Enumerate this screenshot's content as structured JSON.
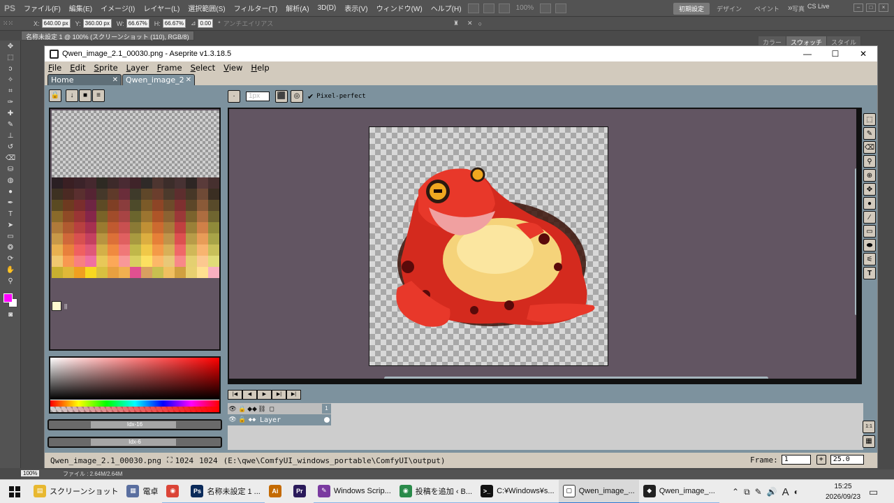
{
  "ps": {
    "logo": "PS",
    "menus": [
      "ファイル(F)",
      "編集(E)",
      "イメージ(I)",
      "レイヤー(L)",
      "選択範囲(S)",
      "フィルター(T)",
      "解析(A)",
      "3D(D)",
      "表示(V)",
      "ウィンドウ(W)",
      "ヘルプ(H)"
    ],
    "zoom_menu": "100%",
    "workspaces": [
      "初期設定",
      "デザイン",
      "ペイント",
      "写真"
    ],
    "search_icon": "»",
    "cs_live": "CS Live",
    "options": {
      "x_label": "X:",
      "x_value": "640.00 px",
      "y_label": "Y:",
      "y_value": "360.00 px",
      "w_label": "W:",
      "w_value": "66.67%",
      "h_label": "H:",
      "h_value": "66.67%",
      "angle_value": "0.00",
      "angle_unit": "°",
      "antialias": "アンチエイリアス",
      "commit_icons": [
        "✕",
        "○"
      ]
    },
    "doc_tab": "名称未設定 1 @ 100% (スクリーンショット (110), RGB/8)",
    "panel_tabs": [
      "カラー",
      "スウォッチ",
      "スタイル"
    ],
    "status_zoom": "100%",
    "status_file": "ファイル : 2.64M/2.64M"
  },
  "aseprite": {
    "title": "Qwen_image_2.1_00030.png - Aseprite v1.3.18.5",
    "win_controls": [
      "—",
      "☐",
      "✕"
    ],
    "menus": [
      "File",
      "Edit",
      "Sprite",
      "Layer",
      "Frame",
      "Select",
      "View",
      "Help"
    ],
    "tabs": [
      {
        "label": "Home",
        "close": "✕"
      },
      {
        "label": "Qwen_image_2",
        "close": "✕"
      }
    ],
    "toolopts": {
      "size_placeholder": "1px",
      "pixel_perfect": "Pixel-perfect",
      "check": "✔"
    },
    "palette": {
      "empty_rows": 6,
      "rows": [
        [
          "#2a1f23",
          "#3a1f23",
          "#3b2329",
          "#45282e",
          "#2e2a23",
          "#3d2a2a",
          "#4a2b33",
          "#3f2429",
          "#2f2a28",
          "#4d3530",
          "#3c2d2a",
          "#473233",
          "#2e2624",
          "#5a3b3a",
          "#46302f"
        ],
        [
          "#3d3122",
          "#4b2a23",
          "#5a2f2f",
          "#552433",
          "#45382a",
          "#5f3a2a",
          "#6a2d3a",
          "#3e3a2a",
          "#5f4729",
          "#6b3e2d",
          "#4c3a2c",
          "#5d2e2e",
          "#473727",
          "#6f4a36",
          "#3a2e22"
        ],
        [
          "#5a4a22",
          "#6e3a20",
          "#7a2d2d",
          "#6e2543",
          "#5d4a25",
          "#7f3f25",
          "#8a3d3d",
          "#4d4a2a",
          "#7b5a28",
          "#8d4526",
          "#6d4a2a",
          "#7f3030",
          "#5c4628",
          "#8a5a38",
          "#584a2a"
        ],
        [
          "#8a6a2a",
          "#8f4a26",
          "#9a3535",
          "#86264a",
          "#7a6328",
          "#a14c2a",
          "#a84444",
          "#6b652d",
          "#9c7530",
          "#ae5528",
          "#8b6232",
          "#9b3838",
          "#7b632d",
          "#ad6d40",
          "#6f6530"
        ],
        [
          "#b07a3a",
          "#b05a30",
          "#b84040",
          "#a63050",
          "#9a7a30",
          "#c05a30",
          "#c85050",
          "#8a7a35",
          "#c09035",
          "#cc6a30",
          "#a87a3a",
          "#c04040",
          "#9a8038",
          "#d08048",
          "#8f8a3a"
        ],
        [
          "#c89848",
          "#d0683a",
          "#d85050",
          "#c44060",
          "#b89440",
          "#dc7038",
          "#e06060",
          "#a89a40",
          "#dcae40",
          "#e68038",
          "#c0944a",
          "#dd5050",
          "#b89c48",
          "#e89c58",
          "#a8a448"
        ],
        [
          "#e8b050",
          "#e8803c",
          "#f06060",
          "#e05878",
          "#d4b048",
          "#f08a40",
          "#f07878",
          "#c0b84a",
          "#f0c848",
          "#f49a48",
          "#d8b058",
          "#f06868",
          "#d0b858",
          "#f8b470",
          "#c8c05a"
        ],
        [
          "#f0c870",
          "#f89850",
          "#f88080",
          "#f070a0",
          "#e8c858",
          "#fca858",
          "#f89898",
          "#d8d060",
          "#fce060",
          "#fcb868",
          "#e8c878",
          "#f88888",
          "#e4d070",
          "#fcc890",
          "#e0dc78"
        ],
        [
          "#c8b030",
          "#e0b838",
          "#f0a020",
          "#f8d820",
          "#d8c040",
          "#e8a040",
          "#f0b050",
          "#e05090",
          "#d8a060",
          "#c8c050",
          "#f0c060",
          "#d0a040",
          "#e8d070",
          "#ffe090",
          "#f8b0c0"
        ]
      ],
      "last_mark": "■"
    },
    "idx": {
      "fg": "Idx-16",
      "bg": "Idx-6"
    },
    "tools": [
      "⬚",
      "✎",
      "⌫",
      "⚲",
      "⊕",
      "✥",
      "●",
      "∕",
      "▭",
      "⬬",
      "⚟",
      "T"
    ],
    "timeline": {
      "controls": [
        "|◀",
        "◀",
        "▶",
        "▶|",
        "▶|"
      ],
      "header_icons": [
        "👁",
        "🔒",
        "◆◆",
        "⛓",
        "◻"
      ],
      "frame": "1",
      "layer": {
        "eye": "👁",
        "lock": "🔒",
        "cont": "◆◆",
        "name": "Layer"
      },
      "right_icons": [
        "1:1",
        "▦"
      ]
    },
    "status": {
      "file": "Qwen_image_2.1_00030.png",
      "size_icon": "⛶",
      "w": "1024",
      "h": "1024",
      "path": "(E:\\qwe\\ComfyUI_windows_portable\\ComfyUI\\output)",
      "frame_label": "Frame:",
      "frame_value": "1",
      "plus": "+",
      "zoom": "25.0"
    }
  },
  "taskbar": {
    "apps": [
      {
        "label": "スクリーンショット",
        "icon": "▤",
        "color": "#e8b830",
        "state": "none"
      },
      {
        "label": "電卓",
        "icon": "▦",
        "color": "#5a6fa0",
        "state": "none"
      },
      {
        "label": "",
        "icon": "◉",
        "color": "#db4437",
        "state": "open"
      },
      {
        "label": "名称未設定 1 ...",
        "icon": "Ps",
        "color": "#0a2a5a",
        "state": "open"
      },
      {
        "label": "",
        "icon": "Ai",
        "color": "#c46a00",
        "state": "none"
      },
      {
        "label": "",
        "icon": "Pr",
        "color": "#2a1a5a",
        "state": "none"
      },
      {
        "label": "Windows Scrip...",
        "icon": "✎",
        "color": "#7a3aa0",
        "state": "open"
      },
      {
        "label": "投稿を追加 ‹ B...",
        "icon": "◉",
        "color": "#2a8a4a",
        "state": "open"
      },
      {
        "label": "C:¥Windows¥s...",
        "icon": ">_",
        "color": "#111111",
        "state": "open"
      },
      {
        "label": "Qwen_image_...",
        "icon": "▢",
        "color": "#ffffff",
        "state": "active"
      },
      {
        "label": "Qwen_image_...",
        "icon": "◆",
        "color": "#222222",
        "state": "open"
      }
    ],
    "tray_icons": [
      "⌃",
      "⧉",
      "✎",
      "🔊",
      "A",
      "◐"
    ],
    "time": "15:25",
    "date": "2026/09/23",
    "notif": "▭"
  }
}
